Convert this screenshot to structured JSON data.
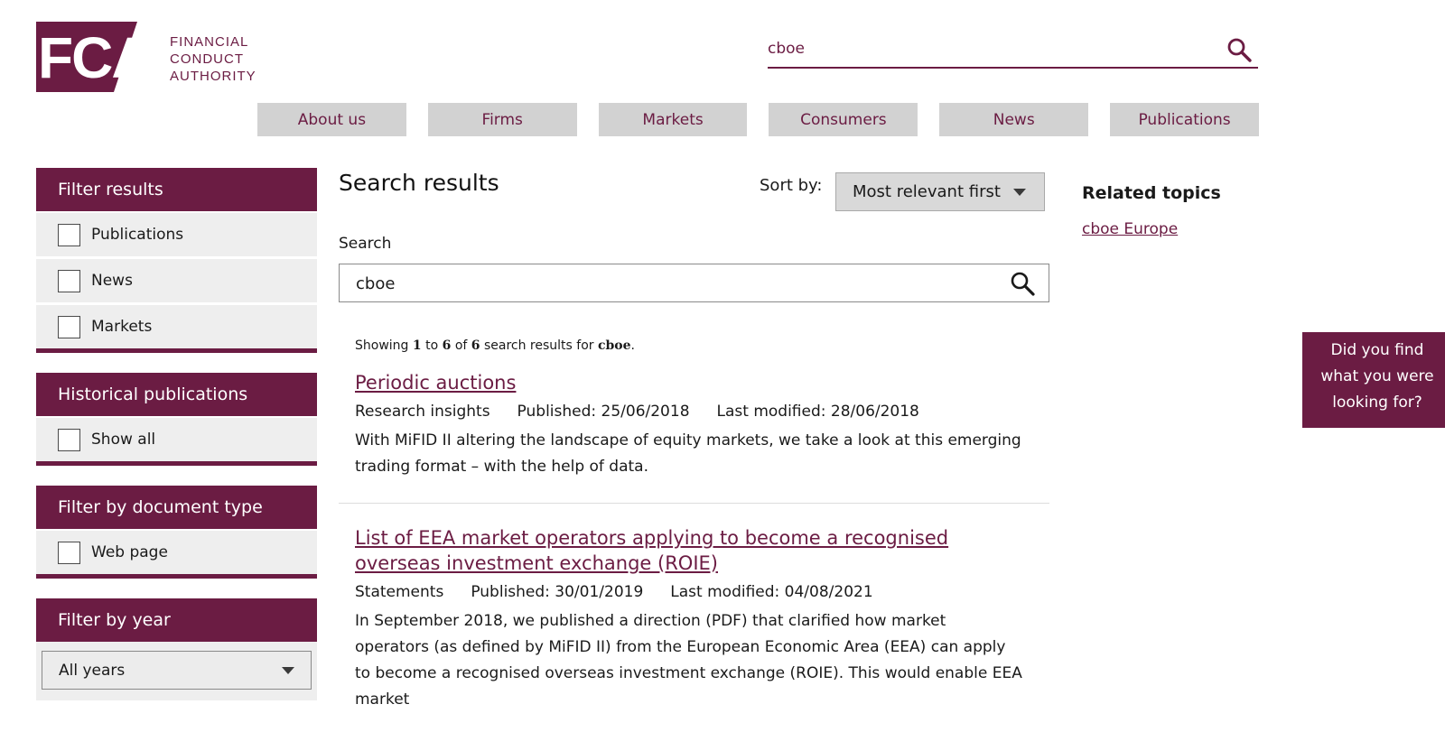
{
  "logo": {
    "mark": "FCA",
    "line1": "FINANCIAL",
    "line2": "CONDUCT",
    "line3": "AUTHORITY"
  },
  "header_search": {
    "value": "cboe",
    "icon": "search-icon"
  },
  "nav": {
    "items": [
      "About us",
      "Firms",
      "Markets",
      "Consumers",
      "News",
      "Publications"
    ]
  },
  "filters": {
    "filter_results": {
      "title": "Filter results",
      "options": [
        "Publications",
        "News",
        "Markets"
      ]
    },
    "historical": {
      "title": "Historical publications",
      "options": [
        "Show all"
      ]
    },
    "doc_type": {
      "title": "Filter by document type",
      "options": [
        "Web page"
      ]
    },
    "year": {
      "title": "Filter by year",
      "selected": "All years"
    }
  },
  "main": {
    "title": "Search results",
    "sort_label": "Sort by:",
    "sort_selected": "Most relevant first",
    "search_label": "Search",
    "search_value": "cboe",
    "showing": {
      "prefix": "Showing",
      "from": "1",
      "to_word": "to",
      "to": "6",
      "of_word": "of",
      "total": "6",
      "suffix": "search results for",
      "query": "cboe",
      "end": "."
    },
    "results": [
      {
        "title": "Periodic auctions",
        "category": "Research insights",
        "published": "Published: 25/06/2018",
        "modified": "Last modified: 28/06/2018",
        "description": "With MiFID II altering the landscape of equity markets, we take a look at this emerging trading format – with the help of data."
      },
      {
        "title": "List of EEA market operators applying to become a recognised overseas investment exchange (ROIE)",
        "category": "Statements",
        "published": "Published: 30/01/2019",
        "modified": "Last modified: 04/08/2021",
        "description": "In September 2018, we published a direction (PDF) that clarified how market operators (as defined by MiFID II) from the European Economic Area (EEA) can apply to become a recognised overseas investment exchange (ROIE). This would enable EEA market"
      }
    ]
  },
  "related": {
    "title": "Related topics",
    "links": [
      "cboe Europe"
    ]
  },
  "feedback": {
    "line1": "Did you find",
    "line2": "what you were",
    "line3": "looking for?"
  },
  "colors": {
    "brand": "#6b1c43",
    "nav_bg": "#d2d2d2",
    "filter_option_bg": "#eeeeee"
  }
}
